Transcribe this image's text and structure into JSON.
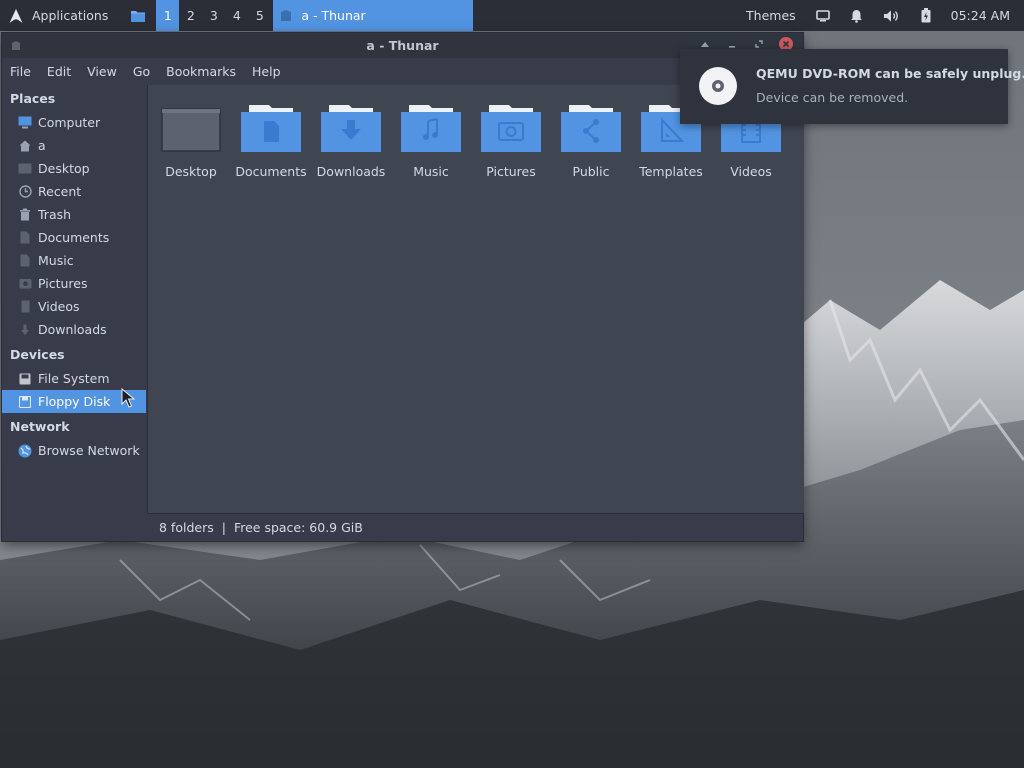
{
  "panel": {
    "applications_label": "Applications",
    "workspaces": [
      "1",
      "2",
      "3",
      "4",
      "5"
    ],
    "active_workspace": "1",
    "task_title": "a - Thunar",
    "themes_label": "Themes",
    "clock": "05:24 AM",
    "icons": [
      "arch-logo-icon",
      "file-manager-icon",
      "display-icon",
      "bell-icon",
      "volume-icon",
      "battery-icon"
    ]
  },
  "window": {
    "title": "a - Thunar",
    "menu": [
      "File",
      "Edit",
      "View",
      "Go",
      "Bookmarks",
      "Help"
    ]
  },
  "sidebar": {
    "places_heading": "Places",
    "places": [
      {
        "label": "Computer",
        "icon": "computer-icon"
      },
      {
        "label": "a",
        "icon": "home-icon"
      },
      {
        "label": "Desktop",
        "icon": "desktop-icon"
      },
      {
        "label": "Recent",
        "icon": "recent-icon"
      },
      {
        "label": "Trash",
        "icon": "trash-icon"
      },
      {
        "label": "Documents",
        "icon": "documents-icon"
      },
      {
        "label": "Music",
        "icon": "music-icon"
      },
      {
        "label": "Pictures",
        "icon": "pictures-icon"
      },
      {
        "label": "Videos",
        "icon": "videos-icon"
      },
      {
        "label": "Downloads",
        "icon": "downloads-icon"
      }
    ],
    "devices_heading": "Devices",
    "devices": [
      {
        "label": "File System",
        "icon": "drive-icon"
      },
      {
        "label": "Floppy Disk",
        "icon": "floppy-icon",
        "selected": true
      }
    ],
    "network_heading": "Network",
    "network": [
      {
        "label": "Browse Network",
        "icon": "network-icon"
      }
    ]
  },
  "folders": [
    {
      "label": "Desktop",
      "icon": "desktop-folder-icon"
    },
    {
      "label": "Documents",
      "icon": "documents-folder-icon"
    },
    {
      "label": "Downloads",
      "icon": "downloads-folder-icon"
    },
    {
      "label": "Music",
      "icon": "music-folder-icon"
    },
    {
      "label": "Pictures",
      "icon": "pictures-folder-icon"
    },
    {
      "label": "Public",
      "icon": "public-folder-icon"
    },
    {
      "label": "Templates",
      "icon": "templates-folder-icon"
    },
    {
      "label": "Videos",
      "icon": "videos-folder-icon"
    }
  ],
  "status": {
    "count": "8 folders",
    "separator": "|",
    "free_space": "Free space: 60.9 GiB"
  },
  "notification": {
    "title": "QEMU DVD-ROM can be safely unplug...",
    "body": "Device can be removed.",
    "icon": "optical-disc-icon"
  },
  "colors": {
    "accent": "#5294e2",
    "panel": "#2b2e37",
    "window": "#383c4a",
    "content": "#404552",
    "close": "#cc575d"
  }
}
